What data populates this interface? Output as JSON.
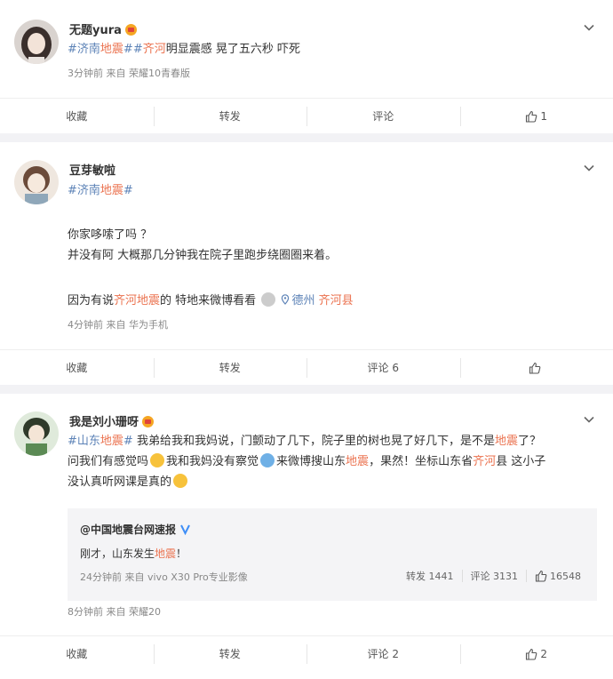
{
  "posts": [
    {
      "user": "无题yura",
      "text": [
        "#济南地震#",
        "#齐河",
        "明显震感 晃了五六秒 吓死"
      ],
      "meta": "3分钟前  来自 荣耀10青春版",
      "actions": {
        "fav": "收藏",
        "repost": "转发",
        "comment": "评论",
        "like": "1"
      }
    },
    {
      "user": "豆芽敏啦",
      "tag": "#济南地震#",
      "line1": "你家哆嗦了吗 ？",
      "line2": "并没有阿 大概那几分钟我在院子里跑步绕圈圈来着。",
      "line3_prefix": "因为有说",
      "line3_tag": "齐河地震",
      "line3_suffix": "的 特地来微博看看",
      "loc_city": "德州",
      "loc_county": "齐河县",
      "meta": "4分钟前  来自 华为手机",
      "actions": {
        "fav": "收藏",
        "repost": "转发",
        "comment": "评论 6",
        "like": ""
      }
    },
    {
      "user": "我是刘小珊呀",
      "tag": "#山东地震#",
      "t1": " 我弟给我和我妈说，门颤动了几下，院子里的树也晃了好几下，是不是",
      "t1_red": "地震",
      "t1_end": "了？",
      "t2": "问我们有感觉吗",
      "t2b": "我和我妈没有察觉",
      "t2c": "来微博搜山东",
      "t2_red": "地震",
      "t2d": "，果然！坐标山东省",
      "t2_red2": "齐河",
      "t2e": "县 这小子",
      "t3": "没认真听网课是真的",
      "repost_user": "@中国地震台网速报",
      "repost_text_a": "刚才，山东发生",
      "repost_text_red": "地震",
      "repost_text_b": "！",
      "repost_meta": "24分钟前  来自 vivo X30 Pro专业影像",
      "repost_actions": {
        "repost": "转发 1441",
        "comment": "评论 3131",
        "like": "16548"
      },
      "meta": "8分钟前  来自 荣耀20",
      "actions": {
        "fav": "收藏",
        "repost": "转发",
        "comment": "评论 2",
        "like": "2"
      }
    }
  ],
  "colors": {
    "accent": "#eb7350",
    "link": "#5d83b7",
    "vip": "#f5a623"
  }
}
